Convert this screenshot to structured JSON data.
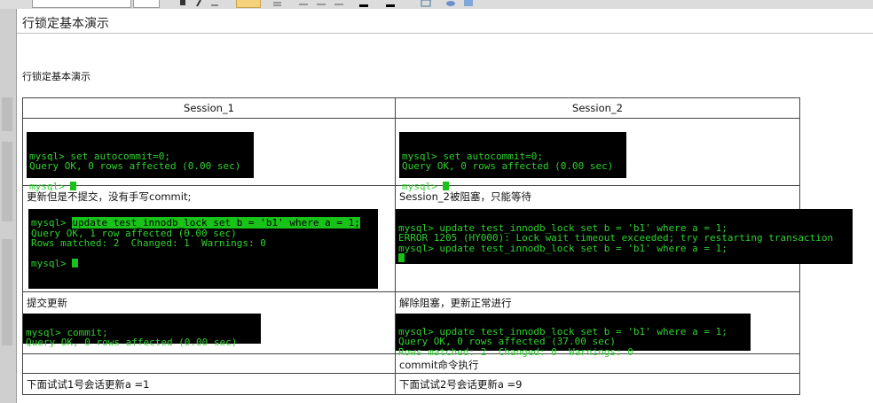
{
  "document": {
    "title": "行锁定基本演示",
    "subtitle": "行锁定基本演示"
  },
  "table": {
    "headers": [
      "Session_1",
      "Session_2"
    ],
    "row1": {
      "s1_lines": [
        "mysql> set autocommit=0;",
        "Query OK, 0 rows affected (0.00 sec)",
        "",
        "mysql> "
      ],
      "s2_lines": [
        "mysql> set autocommit=0;",
        "Query OK, 0 rows affected (0.00 sec)",
        "",
        "mysql> "
      ]
    },
    "row2": {
      "s1_caption": "更新但是不提交，没有手写commit;",
      "s1_prompt": "mysql> ",
      "s1_highlight": "update test_innodb_lock set b = 'b1' where a = 1;",
      "s1_lines": [
        "Query OK, 1 row affected (0.00 sec)",
        "Rows matched: 2  Changed: 1  Warnings: 0",
        "",
        "mysql> "
      ],
      "s2_caption": "Session_2被阻塞，只能等待",
      "s2_lines": [
        "mysql> update test_innodb_lock set b = 'b1' where a = 1;",
        "ERROR 1205 (HY000): Lock wait timeout exceeded; try restarting transaction",
        "mysql> update test_innodb_lock set b = 'b1' where a = 1;"
      ]
    },
    "row3": {
      "s1_caption": "提交更新",
      "s1_lines": [
        "mysql> commit;",
        "Query OK, 0 rows affected (0.00 sec)"
      ],
      "s2_caption": "解除阻塞，更新正常进行",
      "s2_lines": [
        "mysql> update test_innodb_lock set b = 'b1' where a = 1;",
        "Query OK, 0 rows affected (37.00 sec)",
        "Rows matched: 2  Changed: 0  Warnings: 0"
      ]
    },
    "row4": {
      "s1_caption": "",
      "s2_caption": "commit命令执行"
    },
    "row5": {
      "s1_caption": "下面试试1号会话更新a =1",
      "s2_caption": "下面试试2号会话更新a =9"
    }
  },
  "colors": {
    "terminal_bg": "#000000",
    "terminal_text": "#2fd12f",
    "highlight": "#19c219"
  },
  "toolbar": {
    "icons": [
      "font-dropdown",
      "size-dropdown",
      "bold-icon",
      "italic-icon",
      "underline-icon",
      "align-left-icon",
      "list-icon",
      "align-center-icon",
      "align-right-icon",
      "justify-icon",
      "text-color-icon",
      "highlight-color-icon",
      "table-icon",
      "link-icon",
      "image-icon"
    ]
  }
}
